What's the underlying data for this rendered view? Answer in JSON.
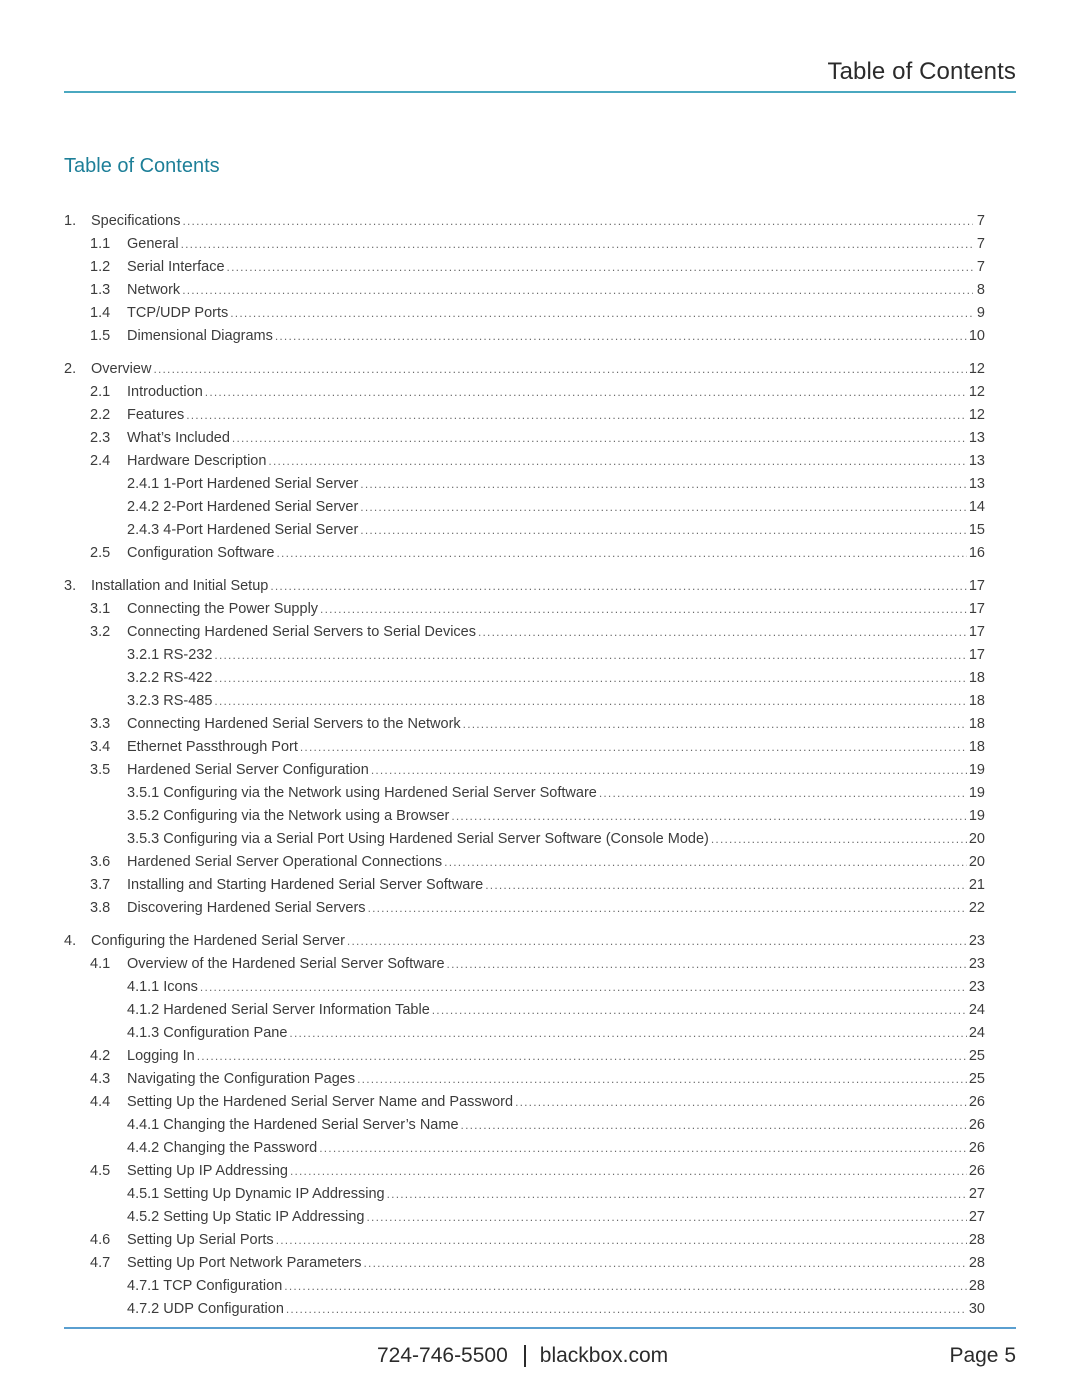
{
  "header": {
    "title": "Table of Contents",
    "accent_color": "#4aa8c0"
  },
  "section_title": "Table of Contents",
  "section_title_color": "#1d7f98",
  "toc": [
    {
      "num": "1.",
      "label": "Specifications",
      "page": "7",
      "children": [
        {
          "num": "1.1",
          "label": "General",
          "page": "7",
          "children": []
        },
        {
          "num": "1.2",
          "label": "Serial Interface",
          "page": "7",
          "children": []
        },
        {
          "num": "1.3",
          "label": "Network",
          "page": "8",
          "children": []
        },
        {
          "num": "1.4",
          "label": "TCP/UDP Ports",
          "page": "9",
          "children": []
        },
        {
          "num": "1.5",
          "label": "Dimensional Diagrams",
          "page": "10",
          "children": []
        }
      ]
    },
    {
      "num": "2.",
      "label": "Overview",
      "page": "12",
      "children": [
        {
          "num": "2.1",
          "label": "Introduction",
          "page": "12",
          "children": []
        },
        {
          "num": "2.2",
          "label": "Features",
          "page": "12",
          "children": []
        },
        {
          "num": "2.3",
          "label": "What’s Included",
          "page": "13",
          "children": []
        },
        {
          "num": "2.4",
          "label": "Hardware Description",
          "page": "13",
          "children": [
            {
              "num": "2.4.1",
              "label": "1-Port Hardened Serial Server",
              "page": "13"
            },
            {
              "num": "2.4.2",
              "label": "2-Port Hardened Serial Server",
              "page": "14"
            },
            {
              "num": "2.4.3",
              "label": "4-Port Hardened Serial Server",
              "page": "15"
            }
          ]
        },
        {
          "num": "2.5",
          "label": "Configuration Software",
          "page": "16",
          "children": []
        }
      ]
    },
    {
      "num": "3.",
      "label": "Installation and Initial Setup",
      "page": "17",
      "children": [
        {
          "num": "3.1",
          "label": "Connecting the Power Supply",
          "page": "17",
          "children": []
        },
        {
          "num": "3.2",
          "label": "Connecting Hardened Serial Servers to Serial Devices",
          "page": "17",
          "children": [
            {
              "num": "3.2.1",
              "label": "RS-232",
              "page": "17"
            },
            {
              "num": "3.2.2",
              "label": "RS-422",
              "page": "18"
            },
            {
              "num": "3.2.3",
              "label": "RS-485",
              "page": "18"
            }
          ]
        },
        {
          "num": "3.3",
          "label": "Connecting Hardened Serial Servers to the Network",
          "page": "18",
          "children": []
        },
        {
          "num": "3.4",
          "label": "Ethernet Passthrough Port",
          "page": "18",
          "children": []
        },
        {
          "num": "3.5",
          "label": "Hardened Serial Server Configuration",
          "page": "19",
          "children": [
            {
              "num": "3.5.1",
              "label": "Configuring via the Network using Hardened Serial Server Software",
              "page": "19"
            },
            {
              "num": "3.5.2",
              "label": "Configuring via the Network using a Browser",
              "page": "19"
            },
            {
              "num": "3.5.3",
              "label": "Configuring via a Serial Port Using Hardened Serial Server Software (Console Mode)",
              "page": "20"
            }
          ]
        },
        {
          "num": "3.6",
          "label": "Hardened Serial Server Operational Connections",
          "page": "20",
          "children": []
        },
        {
          "num": "3.7",
          "label": "Installing and Starting Hardened Serial Server Software",
          "page": "21",
          "children": []
        },
        {
          "num": "3.8",
          "label": "Discovering Hardened Serial Servers",
          "page": "22",
          "children": []
        }
      ]
    },
    {
      "num": "4.",
      "label": "Configuring the Hardened Serial Server",
      "page": "23",
      "children": [
        {
          "num": "4.1",
          "label": "Overview of the Hardened Serial Server Software",
          "page": "23",
          "children": [
            {
              "num": "4.1.1",
              "label": "Icons",
              "page": "23"
            },
            {
              "num": "4.1.2",
              "label": "Hardened Serial Server Information Table",
              "page": "24"
            },
            {
              "num": "4.1.3",
              "label": "Configuration Pane",
              "page": "24"
            }
          ]
        },
        {
          "num": "4.2",
          "label": "Logging In",
          "page": "25",
          "children": []
        },
        {
          "num": "4.3",
          "label": "Navigating the Configuration Pages",
          "page": "25",
          "children": []
        },
        {
          "num": "4.4",
          "label": "Setting Up the Hardened Serial Server Name and Password",
          "page": "26",
          "children": [
            {
              "num": "4.4.1",
              "label": "Changing the Hardened Serial Server’s Name",
              "page": "26"
            },
            {
              "num": "4.4.2",
              "label": "Changing the Password",
              "page": "26"
            }
          ]
        },
        {
          "num": "4.5",
          "label": "Setting Up IP Addressing",
          "page": "26",
          "children": [
            {
              "num": "4.5.1",
              "label": "Setting Up Dynamic IP Addressing",
              "page": "27"
            },
            {
              "num": "4.5.2",
              "label": "Setting Up Static IP Addressing",
              "page": "27"
            }
          ]
        },
        {
          "num": "4.6",
          "label": "Setting Up Serial Ports",
          "page": "28",
          "children": []
        },
        {
          "num": "4.7",
          "label": "Setting Up Port Network Parameters",
          "page": "28",
          "children": [
            {
              "num": "4.7.1",
              "label": "TCP Configuration",
              "page": "28"
            },
            {
              "num": "4.7.2",
              "label": "UDP Configuration",
              "page": "30"
            }
          ]
        }
      ]
    }
  ],
  "footer": {
    "phone": "724-746-5500",
    "website": "blackbox.com",
    "page_label": "Page 5",
    "accent_color": "#5a9fd0"
  }
}
